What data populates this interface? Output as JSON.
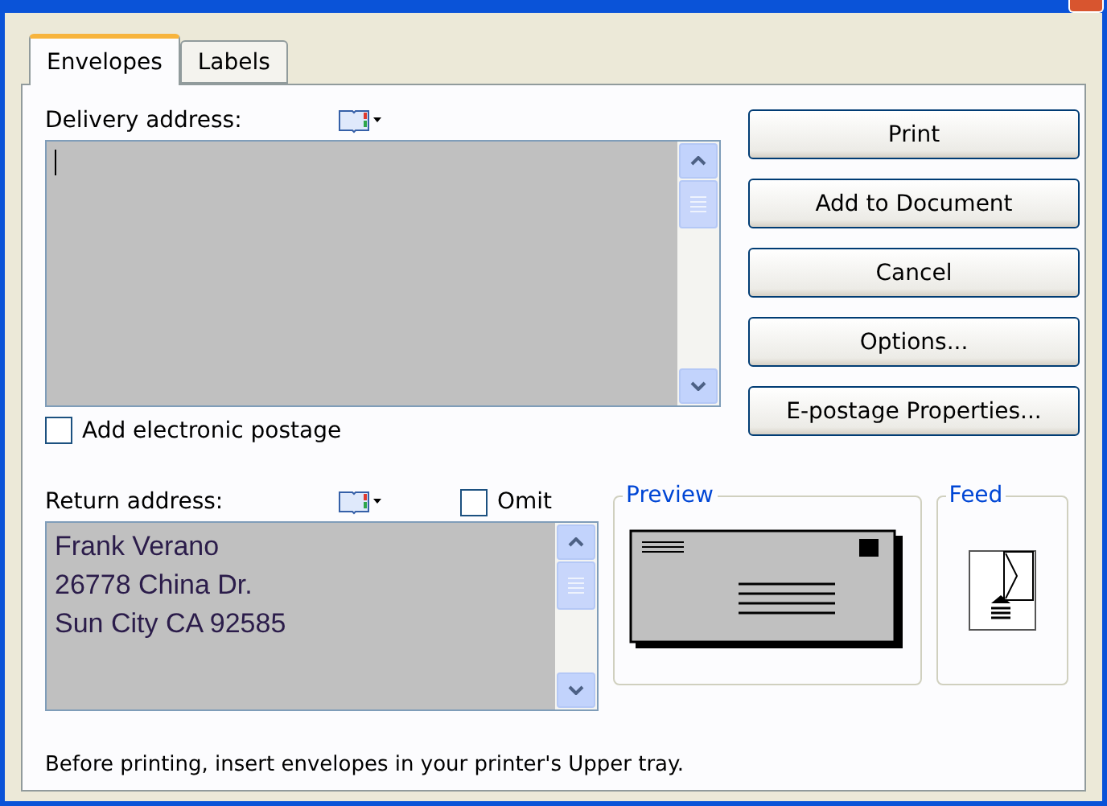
{
  "tabs": [
    {
      "label": "Envelopes",
      "selected": true
    },
    {
      "label": "Labels",
      "selected": false
    }
  ],
  "delivery": {
    "label": "Delivery address:"
  },
  "electronic_postage": {
    "label": "Add electronic postage",
    "checked": false
  },
  "return": {
    "label": "Return address:",
    "omit": {
      "label": "Omit",
      "checked": false
    },
    "lines": [
      "Frank Verano",
      "26778 China Dr.",
      "Sun City CA 92585"
    ]
  },
  "buttons": [
    "Print",
    "Add to Document",
    "Cancel",
    "Options...",
    "E-postage Properties..."
  ],
  "preview": {
    "title": "Preview"
  },
  "feed": {
    "title": "Feed"
  },
  "status": "Before printing, insert envelopes in your printer's Upper tray."
}
